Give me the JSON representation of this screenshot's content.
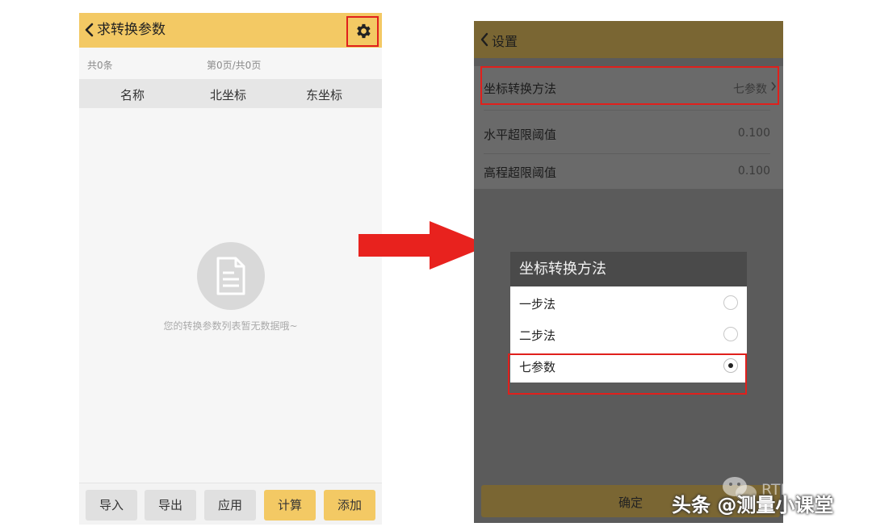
{
  "left_screen": {
    "header": {
      "title": "求转换参数",
      "settings_icon": "gear-icon"
    },
    "info": {
      "count": "共0条",
      "pagination": "第0页/共0页"
    },
    "columns": [
      "名称",
      "北坐标",
      "东坐标"
    ],
    "empty_state": {
      "icon": "document-icon",
      "message": "您的转换参数列表暂无数据哦~"
    },
    "footer_buttons": [
      {
        "label": "导入"
      },
      {
        "label": "导出"
      },
      {
        "label": "应用"
      },
      {
        "label": "计算"
      },
      {
        "label": "添加"
      }
    ]
  },
  "right_screen": {
    "header": {
      "title": "设置"
    },
    "settings": [
      {
        "label": "坐标转换方法",
        "value": "七参数"
      },
      {
        "label": "水平超限阈值",
        "value": "0.100"
      },
      {
        "label": "高程超限阈值",
        "value": "0.100"
      }
    ],
    "dialog": {
      "title": "坐标转换方法",
      "options": [
        {
          "label": "一步法",
          "selected": false
        },
        {
          "label": "二步法",
          "selected": false
        },
        {
          "label": "七参数",
          "selected": true
        }
      ]
    },
    "confirm_label": "确定"
  },
  "watermark": {
    "rtk": "RTK之家",
    "toutiao": "头条 @测量小课堂"
  },
  "colors": {
    "accent": "#f3c964",
    "highlight": "#e0201c",
    "arrow": "#e8221e"
  }
}
